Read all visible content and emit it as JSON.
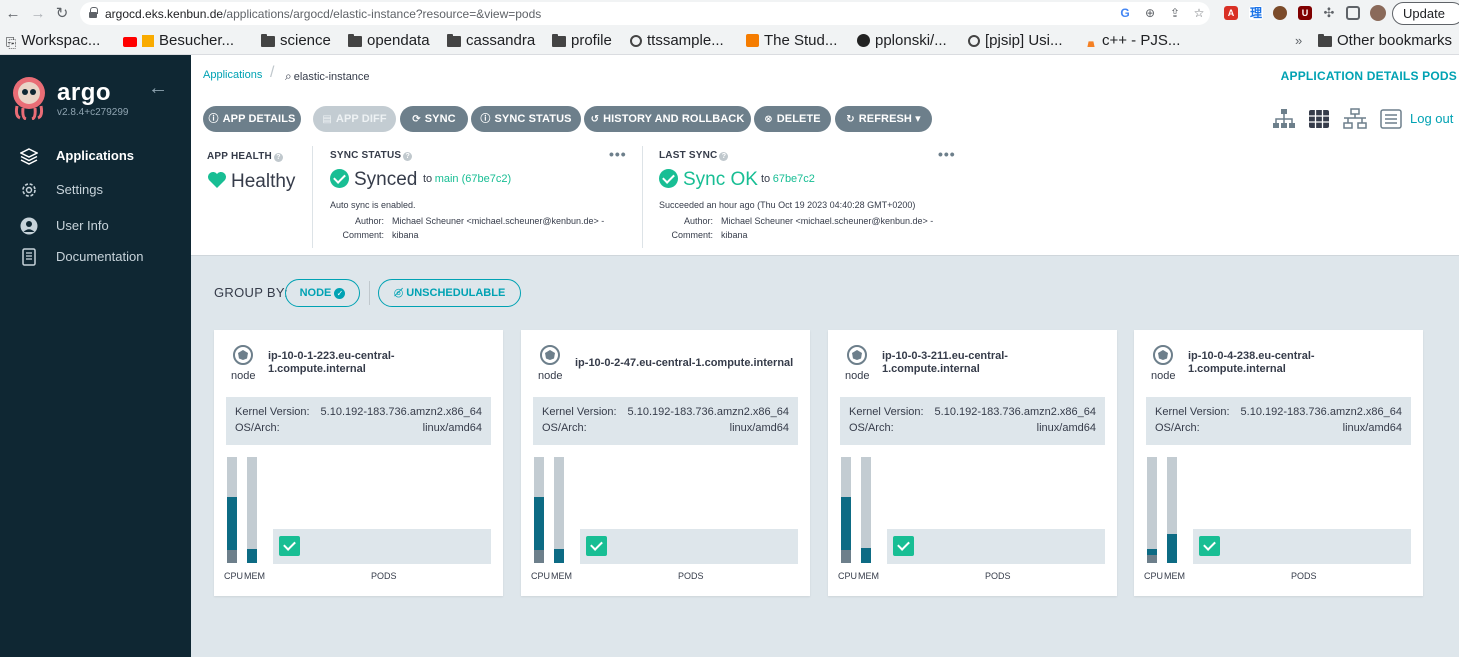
{
  "browser": {
    "url_host": "argocd.eks.kenbun.de",
    "url_path": "/applications/argocd/elastic-instance?resource=&view=pods",
    "update_label": "Update",
    "bookmarks": [
      "Workspac...",
      "Besucher...",
      "science",
      "opendata",
      "cassandra",
      "profile",
      "ttssample...",
      "The Stud...",
      "pplonski/...",
      "[pjsip] Usi...",
      "c++ - PJS...",
      "Other bookmarks"
    ],
    "overflow": "»"
  },
  "sidebar": {
    "brand": "argo",
    "version": "v2.8.4+c279299",
    "items": [
      {
        "label": "Applications",
        "active": true
      },
      {
        "label": "Settings"
      },
      {
        "label": "User Info"
      },
      {
        "label": "Documentation"
      }
    ]
  },
  "header": {
    "breadcrumb_link": "Applications",
    "breadcrumb_current": "elastic-instance",
    "page_title": "APPLICATION DETAILS PODS"
  },
  "toolbar": {
    "app_details": "APP DETAILS",
    "app_diff": "APP DIFF",
    "sync": "SYNC",
    "sync_status": "SYNC STATUS",
    "history": "HISTORY AND ROLLBACK",
    "delete": "DELETE",
    "refresh": "REFRESH",
    "logout": "Log out"
  },
  "status": {
    "health_label": "APP HEALTH",
    "health_value": "Healthy",
    "sync_label": "SYNC STATUS",
    "sync_value": "Synced",
    "sync_to": "to",
    "sync_rev": "main (67be7c2)",
    "sync_auto": "Auto sync is enabled.",
    "author_label": "Author:",
    "comment_label": "Comment:",
    "sync_author": "Michael Scheuner <michael.scheuner@kenbun.de> -",
    "sync_comment": "kibana",
    "last_label": "LAST SYNC",
    "last_value": "Sync OK",
    "last_to": "to",
    "last_rev": "67be7c2",
    "last_when": "Succeeded an hour ago (Thu Oct 19 2023 04:40:28 GMT+0200)",
    "last_author": "Michael Scheuner <michael.scheuner@kenbun.de> -",
    "last_comment": "kibana",
    "menu": "•••"
  },
  "groupby": {
    "label": "GROUP BY:",
    "node": "NODE",
    "unschedulable": "UNSCHEDULABLE"
  },
  "nodes": [
    {
      "kind": "node",
      "name1": "ip-10-0-1-223.eu-central-",
      "name2": "1.compute.internal",
      "kernel_label": "Kernel Version:",
      "kernel": "5.10.192-183.736.amzn2.x86_64",
      "os_label": "OS/Arch:",
      "os": "linux/amd64",
      "cpu_pct": 0.62,
      "cpu_req": 0.12,
      "mem_pct": 0.13,
      "mem_req": 0.0,
      "cpu_lbl": "CPU",
      "mem_lbl": "MEM",
      "pods_lbl": "PODS"
    },
    {
      "kind": "node",
      "name1": "ip-10-0-2-47.eu-central-1.compute.internal",
      "name2": "",
      "kernel_label": "Kernel Version:",
      "kernel": "5.10.192-183.736.amzn2.x86_64",
      "os_label": "OS/Arch:",
      "os": "linux/amd64",
      "cpu_pct": 0.62,
      "cpu_req": 0.12,
      "mem_pct": 0.13,
      "mem_req": 0.0,
      "cpu_lbl": "CPU",
      "mem_lbl": "MEM",
      "pods_lbl": "PODS"
    },
    {
      "kind": "node",
      "name1": "ip-10-0-3-211.eu-central-",
      "name2": "1.compute.internal",
      "kernel_label": "Kernel Version:",
      "kernel": "5.10.192-183.736.amzn2.x86_64",
      "os_label": "OS/Arch:",
      "os": "linux/amd64",
      "cpu_pct": 0.62,
      "cpu_req": 0.12,
      "mem_pct": 0.14,
      "mem_req": 0.0,
      "cpu_lbl": "CPU",
      "mem_lbl": "MEM",
      "pods_lbl": "PODS"
    },
    {
      "kind": "node",
      "name1": "ip-10-0-4-238.eu-central-",
      "name2": "1.compute.internal",
      "kernel_label": "Kernel Version:",
      "kernel": "5.10.192-183.736.amzn2.x86_64",
      "os_label": "OS/Arch:",
      "os": "linux/amd64",
      "cpu_pct": 0.13,
      "cpu_req": 0.08,
      "mem_pct": 0.27,
      "mem_req": 0.0,
      "cpu_lbl": "CPU",
      "mem_lbl": "MEM",
      "pods_lbl": "PODS"
    }
  ],
  "colors": {
    "accent": "#00a2b3",
    "success": "#18be94",
    "sidebar": "#0f2733",
    "bar_fill": "#0d6b84"
  }
}
